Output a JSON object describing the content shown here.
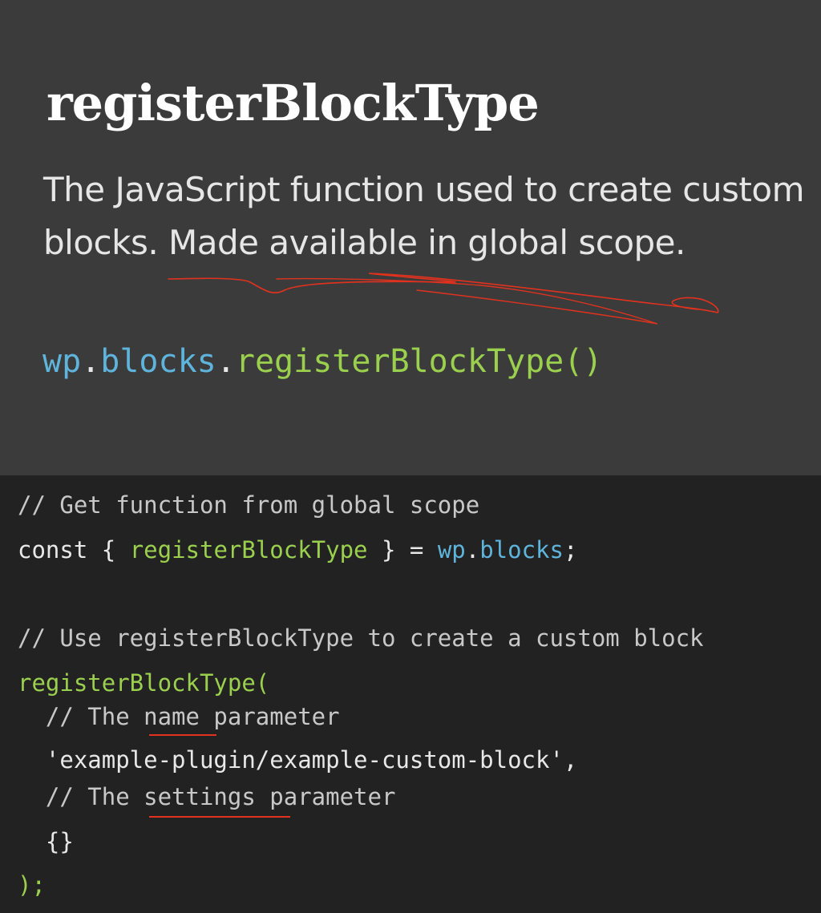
{
  "slide": {
    "title": "registerBlockType",
    "description": "The JavaScript function used to create custom blocks. Made available in global scope.",
    "code": {
      "namespace": "wp",
      "dot1": ".",
      "module": "blocks",
      "dot2": ".",
      "function": "registerBlockType()"
    }
  },
  "code_block": {
    "lines": [
      {
        "text": "// Get function from global scope"
      },
      {
        "keyword": "const",
        "open": " { ",
        "name": "registerBlockType",
        "close": " } = ",
        "ns": "wp",
        "dot": ".",
        "mod": "blocks",
        "end": ";"
      },
      {
        "text": "// Use registerBlockType to create a custom block"
      },
      {
        "text": "registerBlockType("
      },
      {
        "text": "  // The name parameter"
      },
      {
        "text": "  'example-plugin/example-custom-block',"
      },
      {
        "text": "  // The settings parameter"
      },
      {
        "text": "  {}"
      },
      {
        "text": ");"
      }
    ]
  },
  "colors": {
    "slide_background": "#3b3b3b",
    "code_background": "#222222",
    "annotation": "#e0321e",
    "identifier_blue": "#5fb4dc",
    "function_green": "#9bd04e"
  }
}
